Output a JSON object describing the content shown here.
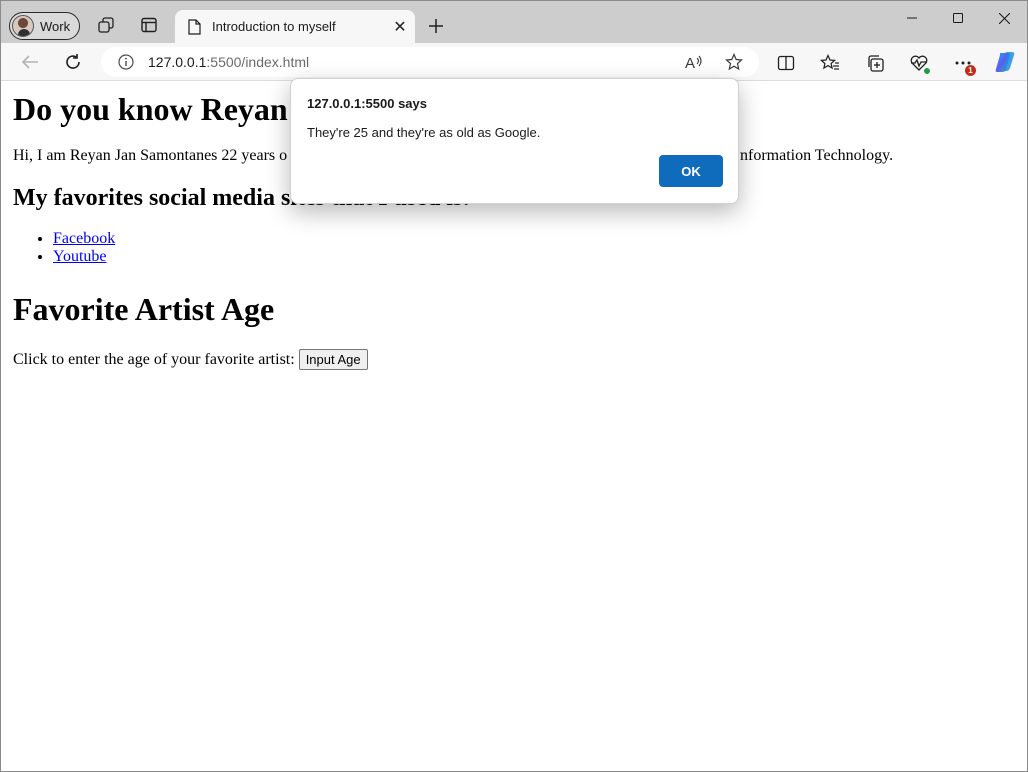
{
  "browser": {
    "profile_label": "Work",
    "tab_title": "Introduction to myself",
    "tab_close_glyph": "✕",
    "new_tab_glyph": "+",
    "url_host": "127.0.0.1",
    "url_rest": ":5500/index.html",
    "icons": {
      "workspaces": "workspaces-icon",
      "tab_actions": "tab-actions-icon",
      "back": "back-arrow-icon",
      "refresh": "refresh-icon",
      "site_info": "info-icon",
      "read_aloud": "read-aloud-icon",
      "favorite": "star-icon",
      "split_screen": "split-screen-icon",
      "favorites": "favorites-icon",
      "collections": "collections-icon",
      "health": "heartbeat-icon",
      "more": "more-icon",
      "copilot": "copilot-icon"
    },
    "more_badge": "1",
    "window_controls": [
      "minimize",
      "maximize",
      "close"
    ]
  },
  "page": {
    "h1": "Do you know Reyan",
    "intro_left": "Hi, I am Reyan Jan Samontanes 22 years o",
    "intro_right": "nformation Technology.",
    "social_heading": "My favorites social media sites that I used is:",
    "links": [
      "Facebook",
      "Youtube"
    ],
    "artist_heading": "Favorite Artist Age",
    "prompt_text": "Click to enter the age of your favorite artist:",
    "button_label": "Input Age"
  },
  "dialog": {
    "title": "127.0.0.1:5500 says",
    "message": "They're 25 and they're as old as Google.",
    "ok_label": "OK"
  },
  "colors": {
    "accent": "#0f6cbd",
    "link": "#0000ee",
    "titlebar": "#cdcdcd",
    "badge": "#c42b1c"
  }
}
